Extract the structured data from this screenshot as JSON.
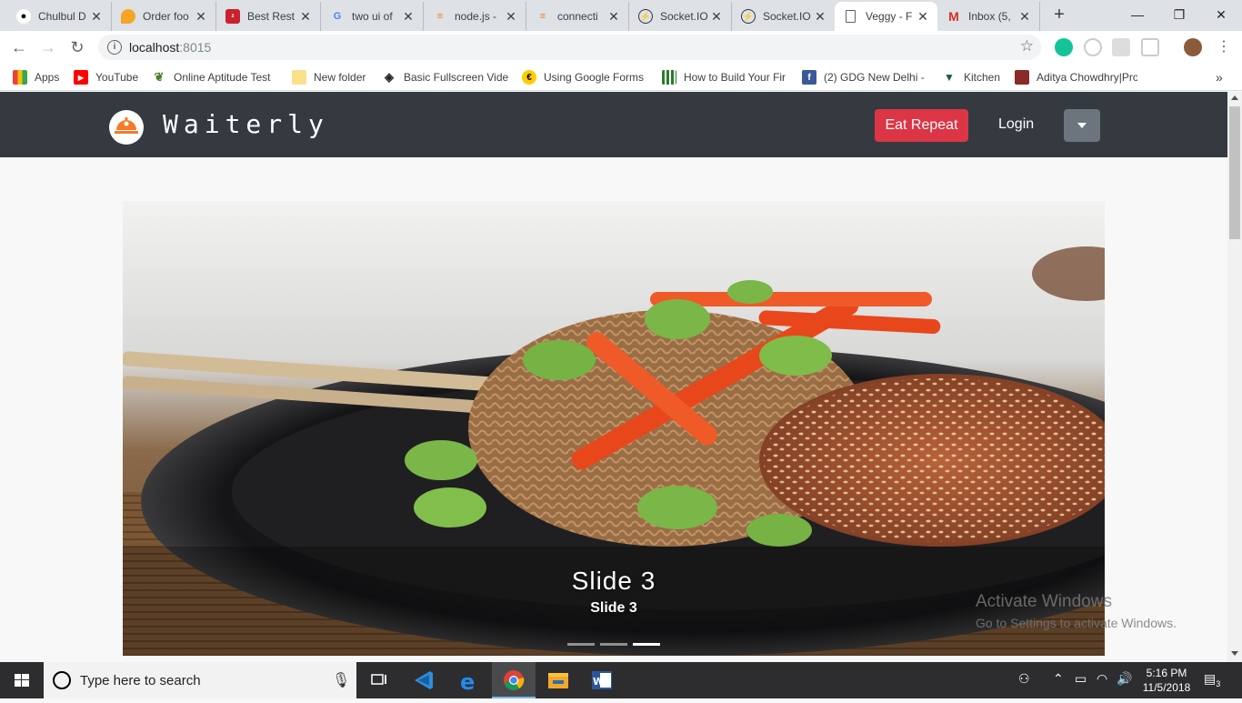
{
  "browser": {
    "tabs": [
      {
        "label": "Chulbul D",
        "icon": "panda-icon"
      },
      {
        "label": "Order foo",
        "icon": "location-pin-icon"
      },
      {
        "label": "Best Rest",
        "icon": "zomato-icon"
      },
      {
        "label": "two ui of",
        "icon": "google-icon"
      },
      {
        "label": "node.js -",
        "icon": "stackoverflow-icon"
      },
      {
        "label": "connecti",
        "icon": "stackoverflow-icon"
      },
      {
        "label": "Socket.IO",
        "icon": "socketio-icon"
      },
      {
        "label": "Socket.IO",
        "icon": "socketio-icon"
      },
      {
        "label": "Veggy - F",
        "icon": "page-icon"
      },
      {
        "label": "Inbox (5,",
        "icon": "gmail-icon"
      }
    ],
    "url": {
      "host": "localhost",
      "port": ":8015"
    },
    "bookmarks": [
      {
        "label": "Apps",
        "icon": "apps-grid-icon"
      },
      {
        "label": "YouTube",
        "icon": "youtube-icon"
      },
      {
        "label": "Online Aptitude Test",
        "icon": "leaf-icon"
      },
      {
        "label": "New folder",
        "icon": "folder-icon"
      },
      {
        "label": "Basic Fullscreen Vide",
        "icon": "codepen-icon"
      },
      {
        "label": "Using Google Forms",
        "icon": "bookmark-icon"
      },
      {
        "label": "How to Build Your Fir",
        "icon": "grid-icon"
      },
      {
        "label": "(2) GDG New Delhi -",
        "icon": "facebook-icon"
      },
      {
        "label": "Kitchen",
        "icon": "vuetify-icon"
      },
      {
        "label": "Aditya Chowdhry|Pro",
        "icon": "profile-icon"
      }
    ]
  },
  "app": {
    "brand": "Waiterly",
    "eat_repeat": "Eat Repeat",
    "login": "Login"
  },
  "carousel": {
    "caption_title": "Slide 3",
    "caption_sub": "Slide 3",
    "slide_count": 3,
    "active_index": 2
  },
  "watermark": {
    "line1": "Activate Windows",
    "line2": "Go to Settings to activate Windows."
  },
  "taskbar": {
    "search_placeholder": "Type here to search",
    "time": "5:16 PM",
    "date": "11/5/2018",
    "notifications": "3"
  },
  "colors": {
    "navbar": "#343a40",
    "eat_button": "#dc3545",
    "dropdown_button": "#6c757d"
  }
}
